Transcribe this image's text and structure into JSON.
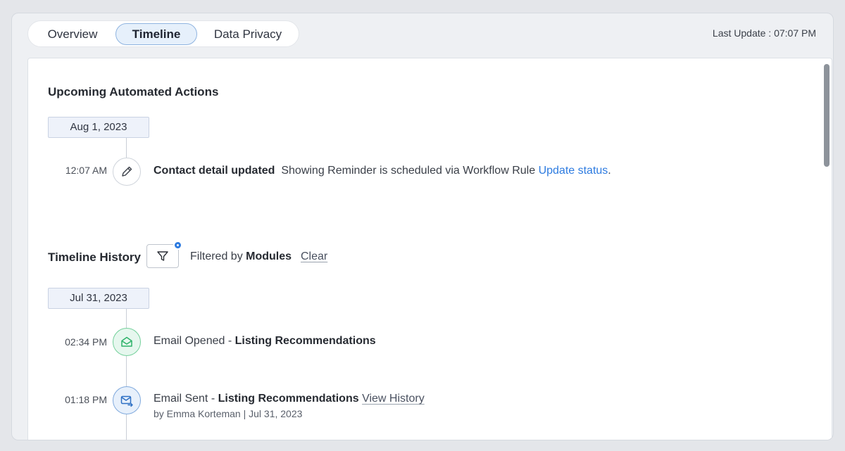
{
  "tabs": [
    "Overview",
    "Timeline",
    "Data Privacy"
  ],
  "active_tab": "Timeline",
  "last_update": "Last Update : 07:07 PM",
  "upcoming": {
    "title": "Upcoming Automated Actions",
    "date": "Aug 1, 2023",
    "item": {
      "time": "12:07 AM",
      "icon": "pencil-icon",
      "title": "Contact detail updated",
      "desc": "Showing Reminder is scheduled via Workflow Rule",
      "link": "Update status",
      "suffix": "."
    }
  },
  "history": {
    "title": "Timeline History",
    "filter_prefix": "Filtered by",
    "filter_value": "Modules",
    "clear_label": "Clear",
    "date": "Jul 31, 2023",
    "items": [
      {
        "time": "02:34 PM",
        "icon": "email-opened-icon",
        "action": "Email Opened",
        "sep": " - ",
        "subject": "Listing Recommendations"
      },
      {
        "time": "01:18 PM",
        "icon": "email-sent-icon",
        "action": "Email Sent",
        "sep": " - ",
        "subject": "Listing Recommendations",
        "link": "View History",
        "byline": "by Emma Korteman | Jul 31, 2023"
      }
    ]
  },
  "colors": {
    "accent": "#2d7be0",
    "opened": "#2fb36a",
    "sent": "#2d6fc4"
  }
}
